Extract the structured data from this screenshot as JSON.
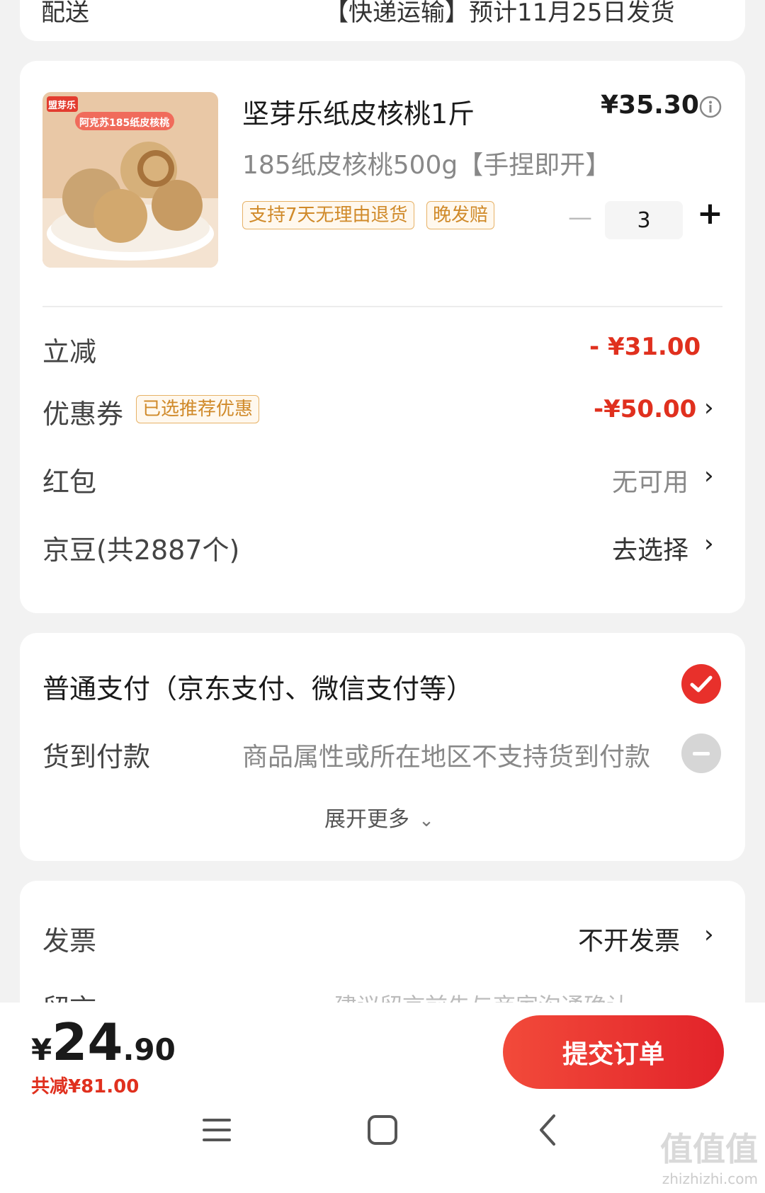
{
  "top_card": {
    "partial_text": "【快递运输】预计11月25日发货"
  },
  "product": {
    "image_badge": "盟芽乐",
    "image_caption": "阿克苏185纸皮核桃",
    "title": "坚芽乐纸皮核桃1斤",
    "price": "¥35.30",
    "spec": "185纸皮核桃500g【手捏即开】",
    "tags": [
      "支持7天无理由退货",
      "晚发赔"
    ],
    "quantity": "3",
    "minus": "—",
    "plus": "+"
  },
  "discounts": {
    "instant_label": "立减",
    "instant_value": "- ¥31.00",
    "coupon_label": "优惠券",
    "coupon_tag": "已选推荐优惠",
    "coupon_value": "-¥50.00",
    "redpacket_label": "红包",
    "redpacket_value": "无可用",
    "jingdou_label": "京豆(共2887个)",
    "jingdou_value": "去选择"
  },
  "payment": {
    "normal_label": "普通支付（京东支付、微信支付等）",
    "cod_label": "货到付款",
    "cod_note": "商品属性或所在地区不支持货到付款",
    "expand_label": "展开更多"
  },
  "invoice": {
    "label": "发票",
    "value": "不开发票",
    "note_label": "留言",
    "note_placeholder": "建议留言前先与商家沟通确认"
  },
  "footer": {
    "currency": "¥",
    "total_int": "24",
    "total_dec": ".90",
    "saved": "共减¥81.00",
    "submit": "提交订单"
  },
  "watermark": {
    "text": "值值值",
    "domain": "zhizhizhi.com"
  },
  "colors": {
    "accent": "#e2232a",
    "tag_border": "#e7b267"
  }
}
